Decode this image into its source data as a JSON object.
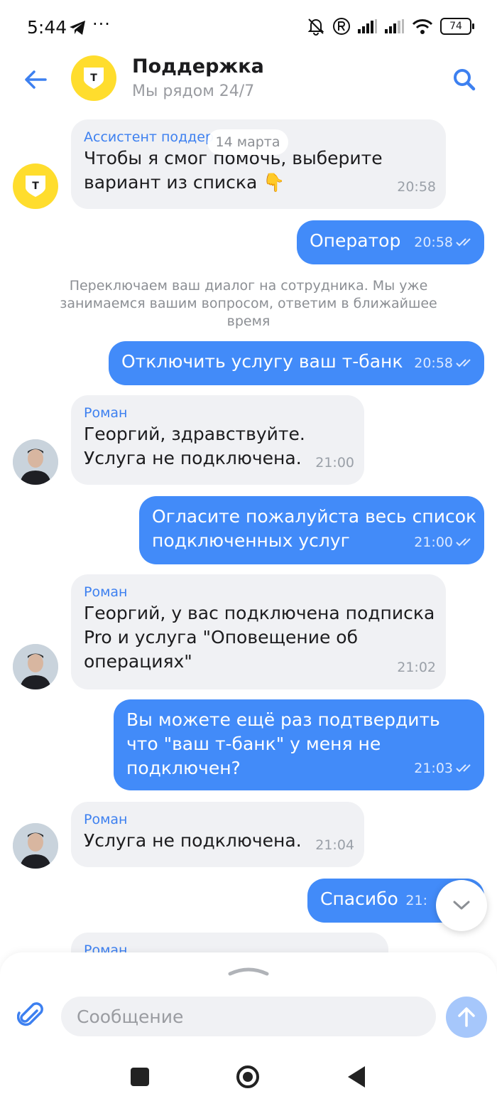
{
  "status_bar": {
    "time": "5:44",
    "dots": "···",
    "battery": "74"
  },
  "header": {
    "title": "Поддержка",
    "subtitle": "Мы рядом 24/7",
    "brand_letter": "Т"
  },
  "date_pill": "14 марта",
  "messages": [
    {
      "sender": "Ассистент поддер",
      "text": "Чтобы я смог помочь, выберите вариант из списка 👇",
      "time": "20:58"
    },
    {
      "text": "Оператор",
      "time": "20:58"
    },
    {
      "text": "Переключаем ваш диалог на сотрудника. Мы уже занимаемся вашим вопросом, ответим в ближайшее время"
    },
    {
      "text": "Отключить услугу ваш т-банк",
      "time": "20:58"
    },
    {
      "sender": "Роман",
      "text": "Георгий, здравствуйте. Услуга не подключена.",
      "time": "21:00"
    },
    {
      "text": "Огласите пожалуйста весь список подключенных услуг",
      "time": "21:00"
    },
    {
      "sender": "Роман",
      "text": "Георгий, у вас подключена подписка Pro и услуга \"Оповещение об операциях\"",
      "time": "21:02"
    },
    {
      "text": "Вы можете ещё раз подтвердить что \"ваш т-банк\" у меня не подключен?",
      "time": "21:03"
    },
    {
      "sender": "Роман",
      "text": "Услуга не подключена.",
      "time": "21:04"
    },
    {
      "text": "Спасибо",
      "time": "21:"
    },
    {
      "sender": "Роман"
    }
  ],
  "composer": {
    "placeholder": "Сообщение"
  },
  "colors": {
    "accent": "#428bf9",
    "brand_yellow": "#ffdd2d",
    "incoming_bg": "#f0f1f4"
  }
}
